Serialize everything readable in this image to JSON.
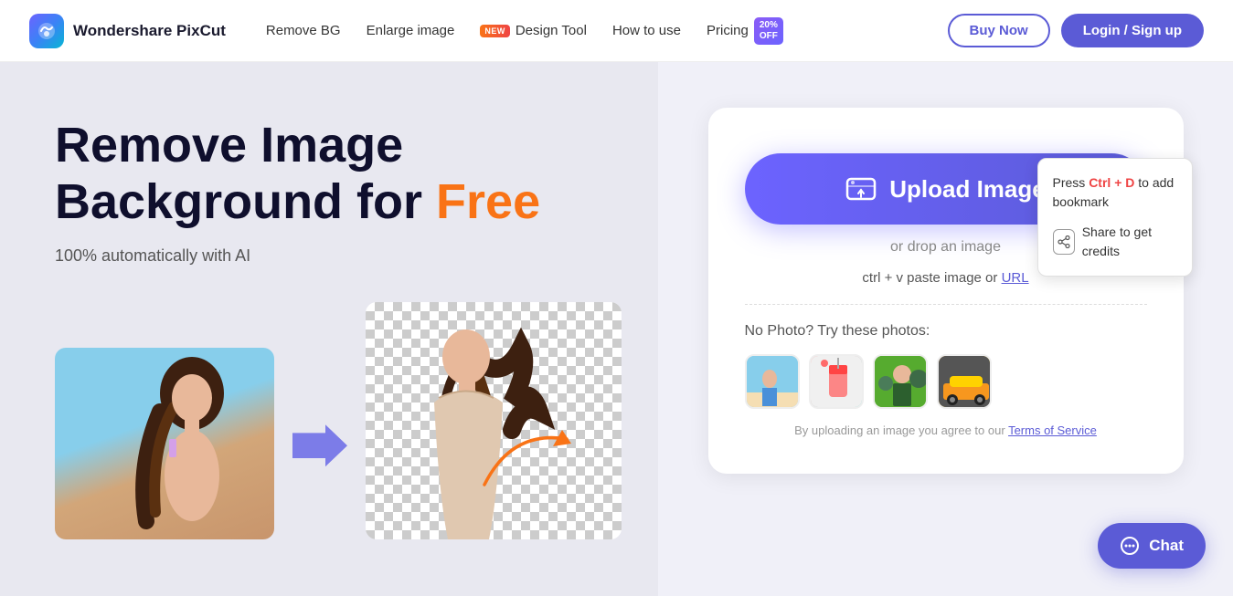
{
  "header": {
    "logo_text": "Wondershare PixCut",
    "nav": [
      {
        "id": "remove-bg",
        "label": "Remove BG",
        "badge": null
      },
      {
        "id": "enlarge-image",
        "label": "Enlarge image",
        "badge": null
      },
      {
        "id": "design-tool",
        "label": "Design Tool",
        "badge": "NEW"
      },
      {
        "id": "how-to-use",
        "label": "How to use",
        "badge": null
      },
      {
        "id": "pricing",
        "label": "Pricing",
        "badge": "20%\nOFF"
      }
    ],
    "buy_now": "Buy Now",
    "login": "Login / Sign up"
  },
  "hero": {
    "title_line1": "Remove Image",
    "title_line2": "Background for ",
    "title_free": "Free",
    "subtitle": "100% automatically with AI"
  },
  "upload_card": {
    "upload_btn_label": "Upload Image",
    "drop_text": "or drop an image",
    "paste_text": "ctrl + v paste image or",
    "paste_link": "URL",
    "try_label": "No Photo? Try these photos:",
    "tos_text": "By uploading an image you agree to our",
    "tos_link": "Terms of Service"
  },
  "bookmark_popup": {
    "line1": "Press ",
    "ctrl_d": "Ctrl + D",
    "line2": " to add bookmark",
    "share_label": "Share to get credits"
  },
  "chat": {
    "label": "Chat"
  }
}
